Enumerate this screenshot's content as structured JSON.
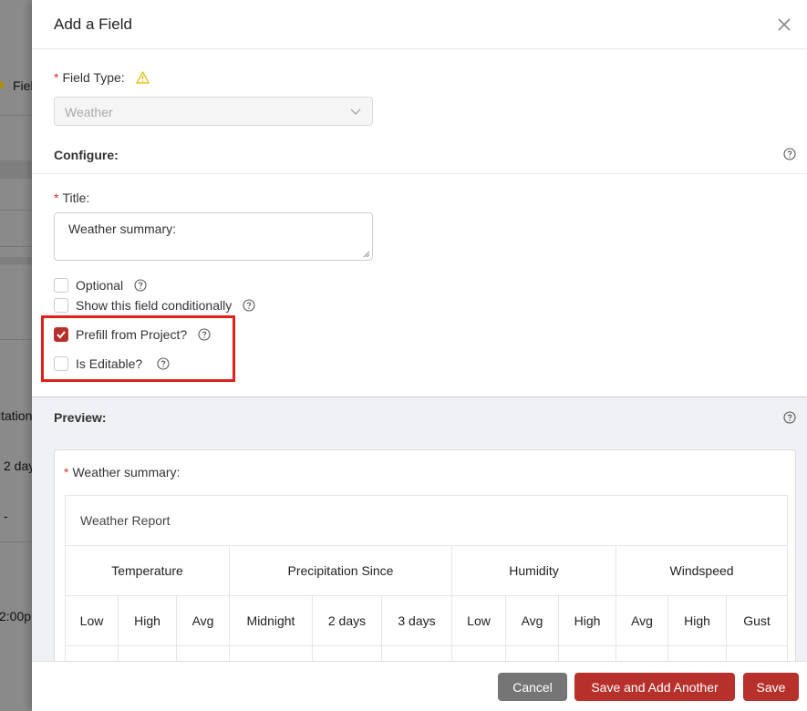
{
  "background": {
    "fragments": [
      "Fiel",
      "itation",
      "2 day",
      "-",
      "2:00p"
    ]
  },
  "drawer": {
    "title": "Add a Field",
    "field_type_label": "Field Type:",
    "field_type_value": "Weather",
    "configure_label": "Configure:",
    "title_label": "Title:",
    "title_value": "Weather summary:",
    "options": [
      {
        "label": "Optional",
        "checked": false
      },
      {
        "label": "Show this field conditionally",
        "checked": false
      },
      {
        "label": "Prefill from Project?",
        "checked": true
      },
      {
        "label": "Is Editable?",
        "checked": false
      }
    ],
    "preview_label": "Preview:",
    "preview": {
      "field_label": "Weather summary:",
      "table_caption": "Weather Report",
      "groups": [
        "Temperature",
        "Precipitation Since",
        "Humidity",
        "Windspeed"
      ],
      "subheaders": [
        "Low",
        "High",
        "Avg",
        "Midnight",
        "2 days",
        "3 days",
        "Low",
        "Avg",
        "High",
        "Avg",
        "High",
        "Gust"
      ]
    },
    "buttons": {
      "cancel": "Cancel",
      "save_another": "Save and Add Another",
      "save": "Save"
    }
  },
  "colors": {
    "brand": "#b7312c",
    "highlight": "#e0201a",
    "required": "#d0342c"
  }
}
